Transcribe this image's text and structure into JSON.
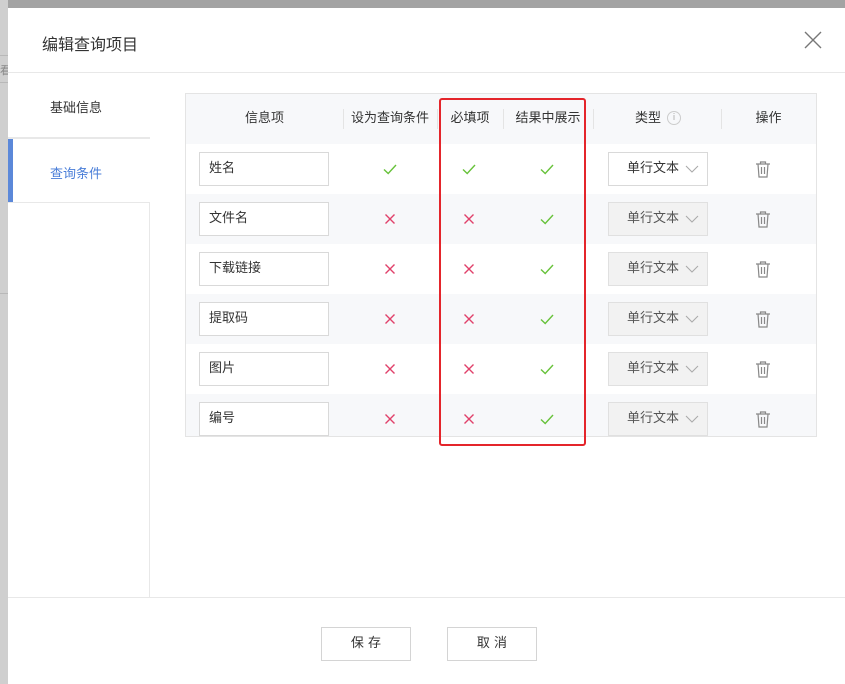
{
  "dialog": {
    "title": "编辑查询项目"
  },
  "background": {
    "fragment": "看"
  },
  "sidebar": {
    "tabs": [
      {
        "label": "基础信息",
        "active": false
      },
      {
        "label": "查询条件",
        "active": true
      }
    ]
  },
  "table": {
    "headers": {
      "field": "信息项",
      "query": "设为查询条件",
      "required": "必填项",
      "display": "结果中展示",
      "type": "类型",
      "ops": "操作"
    },
    "info_icon": "i",
    "rows": [
      {
        "name": "姓名",
        "query": true,
        "required": true,
        "display": true,
        "type": "单行文本",
        "type_editable": true
      },
      {
        "name": "文件名",
        "query": false,
        "required": false,
        "display": true,
        "type": "单行文本",
        "type_editable": false
      },
      {
        "name": "下载链接",
        "query": false,
        "required": false,
        "display": true,
        "type": "单行文本",
        "type_editable": false
      },
      {
        "name": "提取码",
        "query": false,
        "required": false,
        "display": true,
        "type": "单行文本",
        "type_editable": false
      },
      {
        "name": "图片",
        "query": false,
        "required": false,
        "display": true,
        "type": "单行文本",
        "type_editable": false
      },
      {
        "name": "编号",
        "query": false,
        "required": false,
        "display": true,
        "type": "单行文本",
        "type_editable": false
      }
    ]
  },
  "icons": {
    "check": "check-icon",
    "cross": "cross-icon",
    "trash": "trash-icon",
    "close": "close-icon",
    "chevron": "chevron-down-icon",
    "info": "info-icon"
  },
  "colors": {
    "check": "#67c23a",
    "cross": "#e0416a",
    "accent": "#4a7ed8",
    "highlight": "#e4252b"
  },
  "footer": {
    "save_label": "保 存",
    "cancel_label": "取 消"
  }
}
